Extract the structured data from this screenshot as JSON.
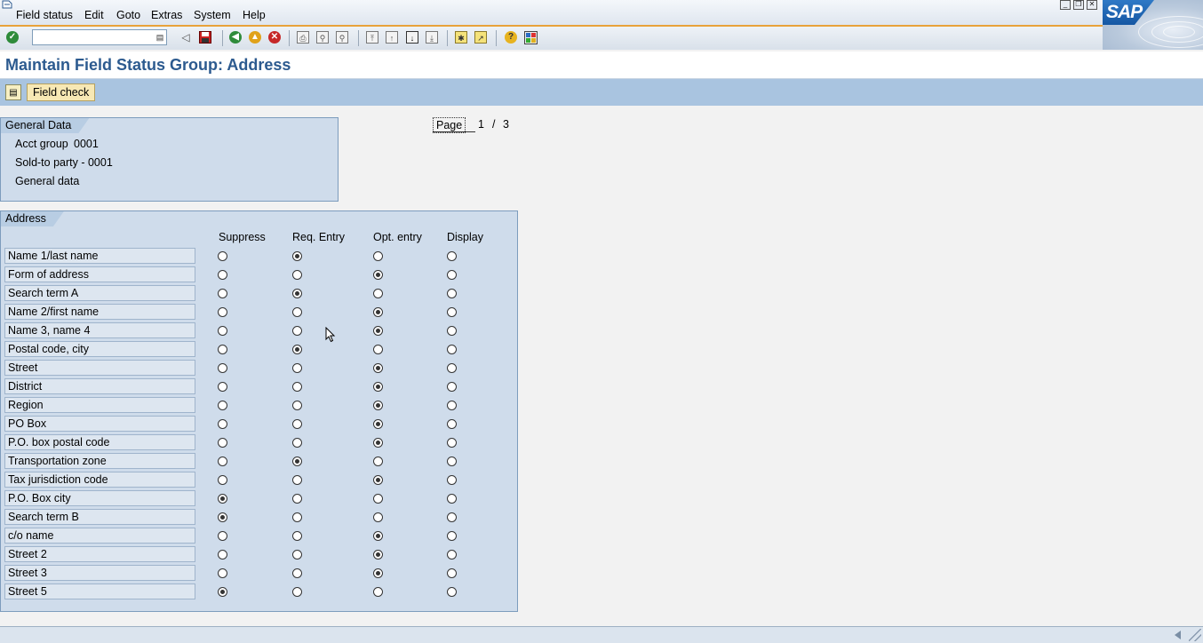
{
  "menu": [
    "Field status",
    "Edit",
    "Goto",
    "Extras",
    "System",
    "Help"
  ],
  "brand": "SAP",
  "command_field": {
    "value": ""
  },
  "title": "Maintain Field Status Group: Address",
  "app_toolbar": {
    "field_check_label": "Field check"
  },
  "general_data": {
    "title": "General Data",
    "acct_group_label": "Acct group",
    "acct_group_value": "0001",
    "line2": "Sold-to party - 0001",
    "line3": "General data"
  },
  "pagination": {
    "label": "Page",
    "current": "1",
    "separator": "/",
    "total": "3"
  },
  "address": {
    "title": "Address",
    "columns": [
      "Suppress",
      "Req. Entry",
      "Opt. entry",
      "Display"
    ],
    "rows": [
      {
        "label": "Name 1/last name",
        "selected": 1
      },
      {
        "label": "Form of address",
        "selected": 2
      },
      {
        "label": "Search term A",
        "selected": 1
      },
      {
        "label": "Name 2/first name",
        "selected": 2
      },
      {
        "label": "Name 3, name 4",
        "selected": 2
      },
      {
        "label": "Postal code, city",
        "selected": 1
      },
      {
        "label": "Street",
        "selected": 2
      },
      {
        "label": "District",
        "selected": 2
      },
      {
        "label": "Region",
        "selected": 2
      },
      {
        "label": "PO Box",
        "selected": 2
      },
      {
        "label": "P.O. box postal code",
        "selected": 2
      },
      {
        "label": "Transportation zone",
        "selected": 1
      },
      {
        "label": "Tax jurisdiction code",
        "selected": 2
      },
      {
        "label": "P.O. Box city",
        "selected": 0
      },
      {
        "label": "Search term B",
        "selected": 0
      },
      {
        "label": "c/o name",
        "selected": 2
      },
      {
        "label": "Street 2",
        "selected": 2
      },
      {
        "label": "Street 3",
        "selected": 2
      },
      {
        "label": "Street 5",
        "selected": 0
      }
    ]
  }
}
